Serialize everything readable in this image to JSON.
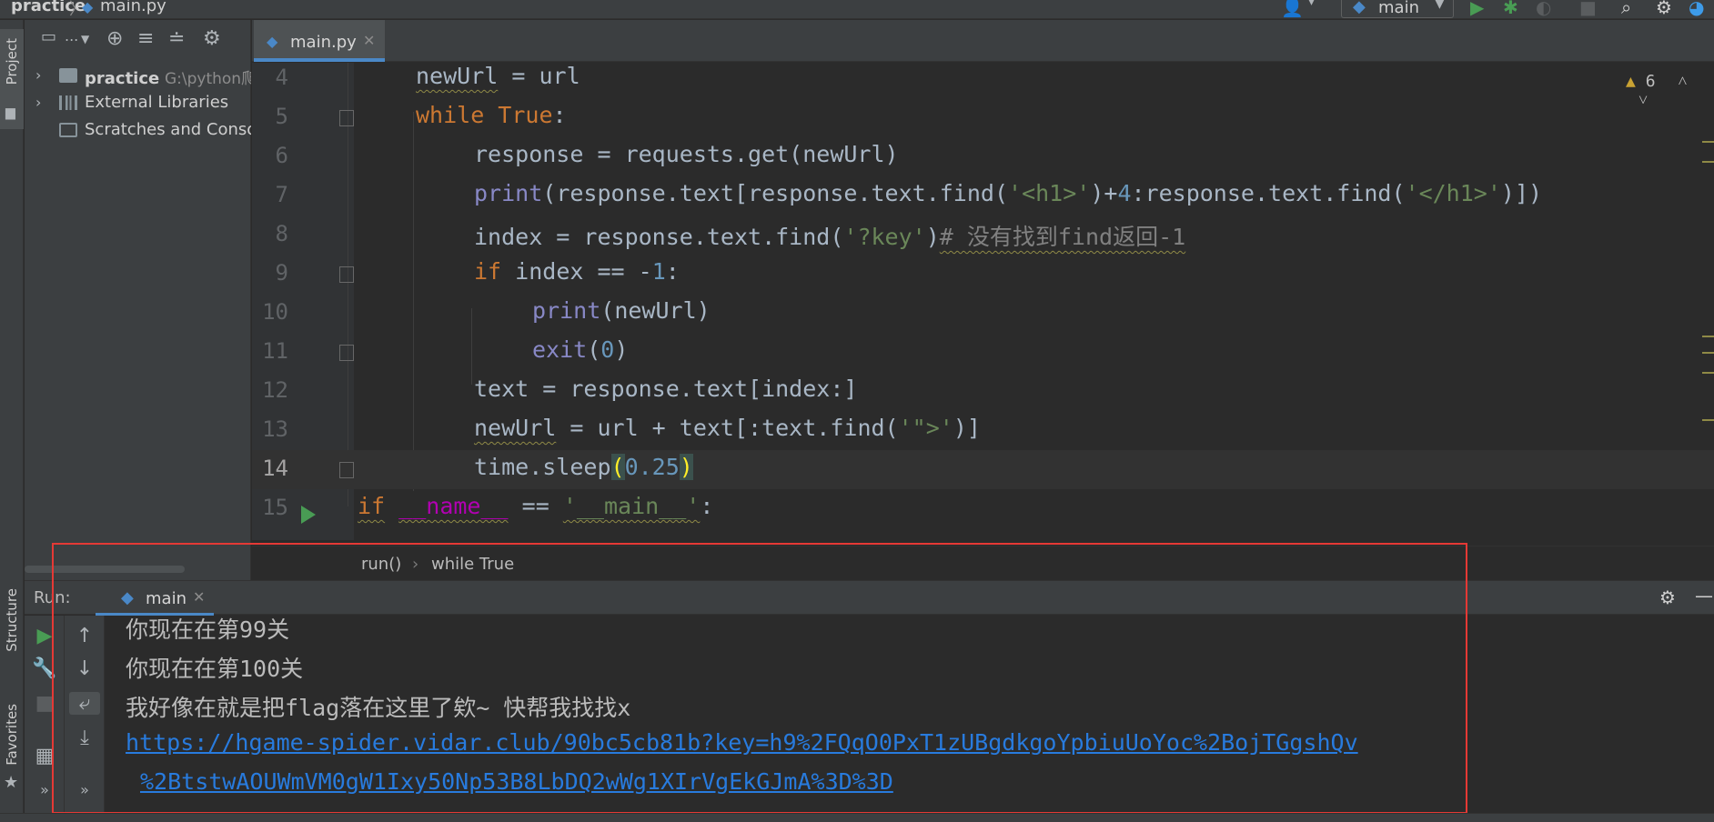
{
  "nav": {
    "project": "practice",
    "file": "main.py",
    "run_config": "main"
  },
  "left_strip": {
    "project": "Project",
    "structure": "Structure",
    "favorites": "Favorites"
  },
  "project_tree": {
    "toolbar_mode": "...",
    "items": [
      {
        "label": "practice",
        "sub": "G:\\python爬"
      },
      {
        "label": "External Libraries",
        "sub": ""
      },
      {
        "label": "Scratches and Consol",
        "sub": ""
      }
    ]
  },
  "editor": {
    "tab": "main.py",
    "inspection_count": "6",
    "line_numbers": [
      "4",
      "5",
      "6",
      "7",
      "8",
      "9",
      "10",
      "11",
      "12",
      "13",
      "14",
      "15"
    ]
  },
  "breadcrumb": {
    "fn": "run()",
    "sep": "›",
    "block": "while True"
  },
  "run": {
    "label": "Run:",
    "tab": "main",
    "output": [
      "你现在在第99关",
      "你现在在第100关",
      "我好像在就是把flag落在这里了欸~ 快帮我找找x"
    ],
    "link_line1": "https://hgame-spider.vidar.club/90bc5cb81b?key=h9%2FQqO0PxT1zUBgdkgoYpbiuUoYoc%2BojTGgshQv",
    "link_line2": "%2BtstwAOUWmVM0gW1Ixy50Np53B8LbDQ2wWg1XIrVgEkGJmA%3D%3D"
  },
  "colors": {
    "accent": "#4a88c7",
    "annotation": "#e53935",
    "keyword": "#cc7832",
    "string": "#6a8759",
    "number": "#6897bb",
    "link": "#287bde"
  }
}
